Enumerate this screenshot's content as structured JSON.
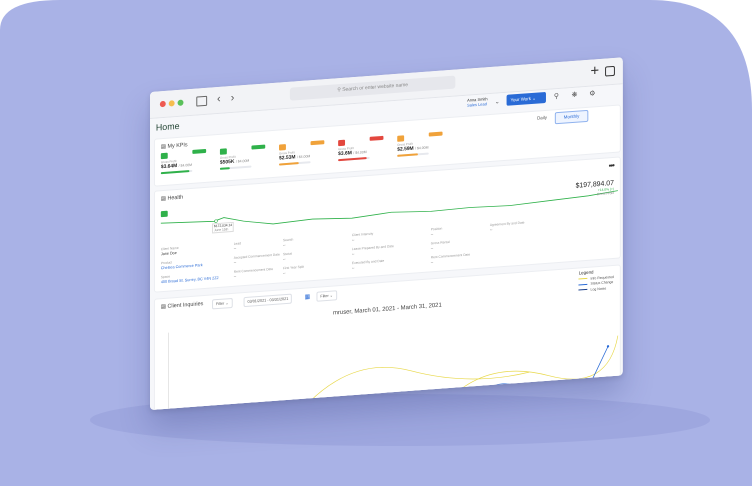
{
  "browser": {
    "search_placeholder": "Search or enter website name",
    "nav_back": "‹",
    "nav_forward": "›",
    "new_tab": "+"
  },
  "header": {
    "page_title": "Home",
    "user_name": "Anna Smith",
    "user_role": "Sales Lead",
    "your_work_label": "Your Work"
  },
  "kpis": {
    "title": "My KPIs",
    "toggle": [
      "Daily",
      "Monthly"
    ],
    "active_toggle": "Monthly",
    "items": [
      {
        "label": "Gross Profit",
        "value": "$3.64M",
        "target": "/ $4.00M",
        "color": "#2fb14a",
        "progress": 0.9
      },
      {
        "label": "Gross Profit",
        "value": "$505K",
        "target": "/ $4.00M",
        "color": "#2fb14a",
        "progress": 0.3
      },
      {
        "label": "Gross Profit",
        "value": "$2.53M",
        "target": "/ $4.00M",
        "color": "#f0a23a",
        "progress": 0.63
      },
      {
        "label": "Gross Profit",
        "value": "$3.6M",
        "target": "/ $4.00M",
        "color": "#e3473e",
        "progress": 0.9
      },
      {
        "label": "Gross Profit",
        "value": "$2.59M",
        "target": "/ $4.00M",
        "color": "#f0a23a",
        "progress": 0.65
      }
    ]
  },
  "health": {
    "title": "Health",
    "value": "$197,894.07",
    "value_change": "+14.0% (+)",
    "value_caption": "Gross Profit",
    "tooltip_value": "$172,034.14",
    "tooltip_date": "June 15th",
    "fields": [
      {
        "label": "Client Name",
        "value": "Jane Doe"
      },
      {
        "label": "Lead",
        "value": "--"
      },
      {
        "label": "Search",
        "value": "--"
      },
      {
        "label": "Client Intensity",
        "value": "--"
      },
      {
        "label": "Position",
        "value": "--"
      },
      {
        "label": "Agreement By and Date",
        "value": "--"
      },
      {
        "label": "Product",
        "value": "Chelsea Commerce Park"
      },
      {
        "label": "Accepted Commencement Date",
        "value": "--"
      },
      {
        "label": "Status",
        "value": "--"
      },
      {
        "label": "Lease Prepared By and Date",
        "value": "--"
      },
      {
        "label": "Gross Rental",
        "value": "--"
      },
      {
        "label": "Space",
        "value": "400 Broad St. Surrey, BC V4N 2Z2"
      },
      {
        "label": "Rent Commencement Date",
        "value": "--"
      },
      {
        "label": "First Year Split",
        "value": "--"
      },
      {
        "label": "Executed By and Date",
        "value": "--"
      },
      {
        "label": "Rent Commencement Date",
        "value": "--"
      }
    ]
  },
  "inquiries": {
    "title": "Client Inquiries",
    "filter_1": "Filter",
    "date_range": "03/01/2021 - 03/31/2021",
    "filter_2": "Filter",
    "chart_title": "mruser, March 01, 2021 - March 31, 2021",
    "legend_title": "Legend",
    "legend": [
      {
        "name": "Info Requested",
        "color": "#e8d84a"
      },
      {
        "name": "Status Change",
        "color": "#2a6bd6"
      },
      {
        "name": "Log Notes",
        "color": "#1b3f8a"
      }
    ]
  },
  "colors": {
    "background_blob": "#a9b2e6",
    "accent": "#2a6bd6",
    "health_line": "#2fb14a"
  }
}
